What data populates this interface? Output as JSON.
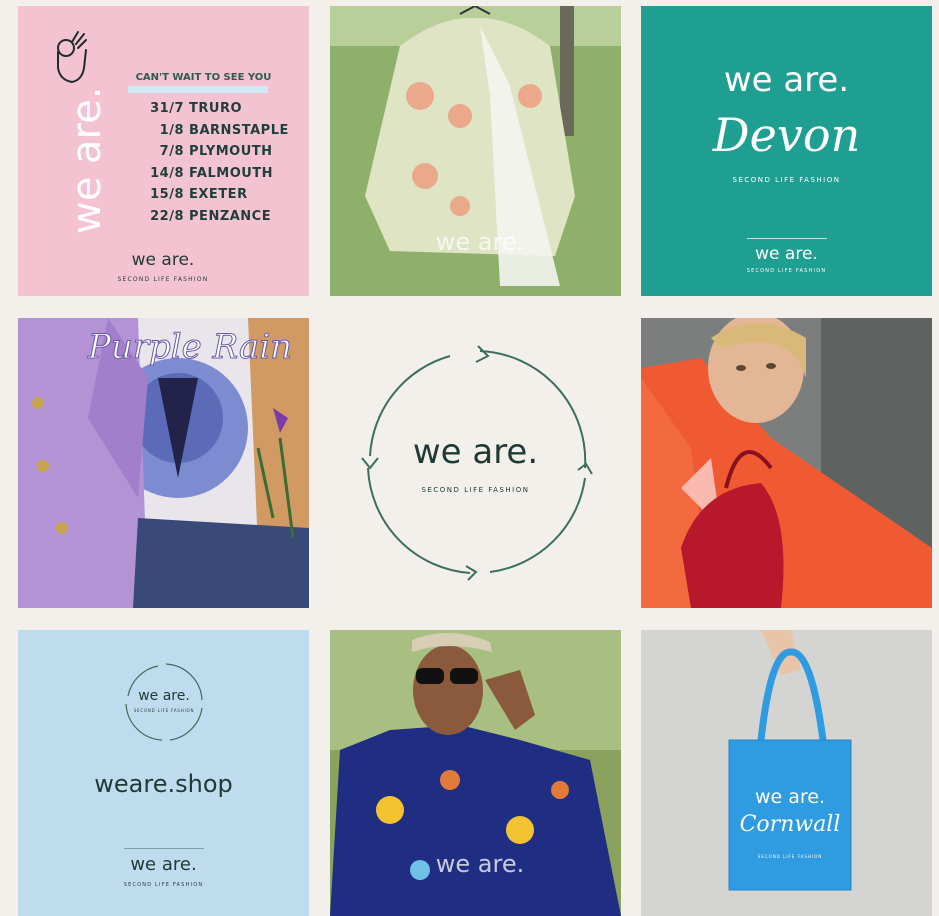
{
  "brand": {
    "name": "we are.",
    "tagline": "SECOND LIFE FASHION",
    "shop_url": "weare.shop"
  },
  "tour": {
    "heading": "CAN'T WAIT TO SEE YOU",
    "dates": [
      {
        "date": "31/7",
        "place": "TRURO"
      },
      {
        "date": "1/8",
        "place": "BARNSTAPLE"
      },
      {
        "date": "7/8",
        "place": "PLYMOUTH"
      },
      {
        "date": "14/8",
        "place": "FALMOUTH"
      },
      {
        "date": "15/8",
        "place": "EXETER"
      },
      {
        "date": "22/8",
        "place": "PENZANCE"
      }
    ]
  },
  "devon": {
    "region": "Devon"
  },
  "cornwall": {
    "region": "Cornwall"
  },
  "colors": {
    "pink": "#f4c3d1",
    "teal": "#1f9f92",
    "light_blue": "#bfdcef",
    "cream": "#f3efeb",
    "dark_green": "#1e3a35",
    "bag_blue": "#2f9be0"
  },
  "icons": [
    "ok-hand-icon",
    "recycle-arrows-icon"
  ],
  "photos": [
    "floral-lace-blouse-photo",
    "purple-rain-tee-flatlay-photo",
    "woman-orange-sweater-red-bag-photo",
    "man-sunglasses-floral-shirt-photo",
    "blue-tote-bag-photo"
  ]
}
